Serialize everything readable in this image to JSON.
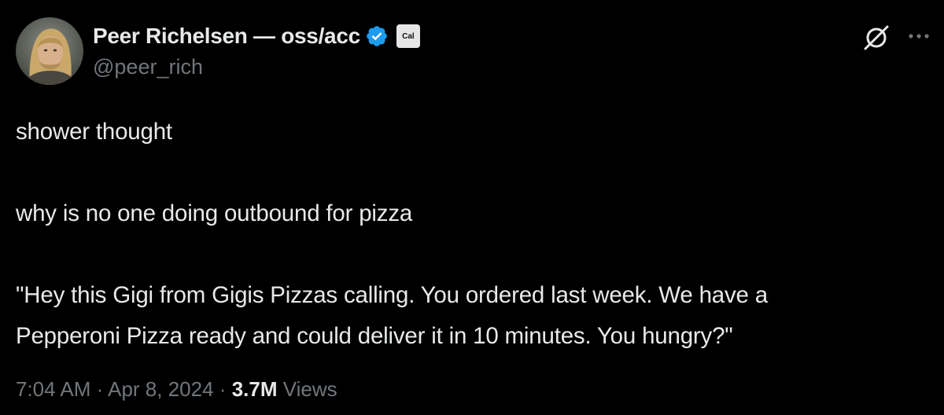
{
  "author": {
    "display_name": "Peer Richelsen — oss/acc",
    "handle": "@peer_rich",
    "affiliate_badge": "Cal",
    "verified_color": "#1d9bf0"
  },
  "header_icons": {
    "grok": "grok-icon",
    "more": "more-icon"
  },
  "tweet": {
    "paragraphs": [
      "shower thought",
      "why is no one doing outbound for pizza",
      "\"Hey this Gigi from Gigis Pizzas calling. You ordered last week. We have a",
      "Pepperoni Pizza ready and could deliver it in 10 minutes. You hungry?\""
    ]
  },
  "meta": {
    "time": "7:04 AM",
    "separator": "·",
    "date": "Apr 8, 2024",
    "views_count": "3.7M",
    "views_label": "Views"
  },
  "colors": {
    "background": "#000000",
    "text": "#e7e9ea",
    "secondary": "#71767b"
  }
}
